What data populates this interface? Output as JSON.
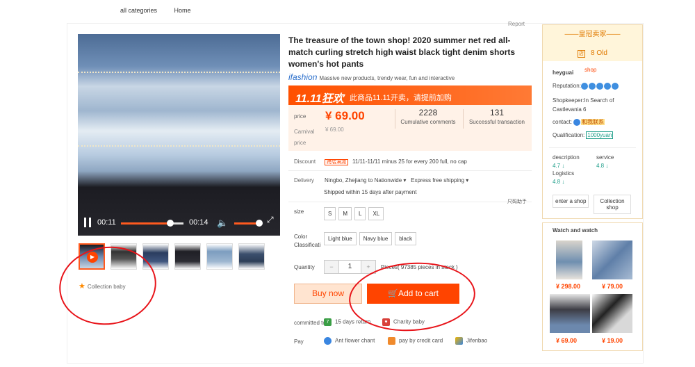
{
  "nav": {
    "all_categories": "all categories",
    "home": "Home"
  },
  "report": "Report",
  "video": {
    "current_time": "00:11",
    "total_time": "00:14",
    "progress": 0.79,
    "volume": 0.85
  },
  "thumbnails": [
    {
      "name": "thumb-1",
      "active": true
    },
    {
      "name": "thumb-2",
      "active": false
    },
    {
      "name": "thumb-3",
      "active": false
    },
    {
      "name": "thumb-4",
      "active": false
    },
    {
      "name": "thumb-5",
      "active": false
    },
    {
      "name": "thumb-6",
      "active": false
    }
  ],
  "collection": "Collection baby",
  "product": {
    "title": "The treasure of the town shop! 2020 summer net red all-match curling stretch high waist black tight denim shorts women's hot pants",
    "ifashion_logo": "ifashion",
    "ifashion_text": "Massive new products, trendy wear, fun and interactive",
    "banner_big": "11.11狂欢",
    "banner_text": "此商品11.11开卖，请提前加购"
  },
  "price": {
    "label": "price",
    "value": "¥ 69.00",
    "carnival_label": "Carnival price",
    "carnival_value": "¥ 69.00",
    "comments_count": "2228",
    "comments_label": "Cumulative comments",
    "transactions_count": "131",
    "transactions_label": "Successful transaction"
  },
  "discount": {
    "label": "Discount",
    "tag": "跨店满减",
    "text": "11/11-11/11 minus 25 for every 200 full, no cap"
  },
  "delivery": {
    "label": "Delivery",
    "route": "Ningbo, Zhejiang to Nationwide",
    "shipping": "Express free shipping",
    "time": "Shipped within 15 days after payment",
    "size_helper": "尺码助手"
  },
  "size": {
    "label": "size",
    "options": [
      "S",
      "M",
      "L",
      "XL"
    ]
  },
  "color": {
    "label": "Color Classificati",
    "options": [
      "Light blue",
      "Navy blue",
      "black"
    ]
  },
  "quantity": {
    "label": "Quantity",
    "minus": "−",
    "value": "1",
    "plus": "+",
    "stock": "Pieces( 97385 pieces in stock )"
  },
  "buttons": {
    "buy_now": "Buy now",
    "add_to_cart": "Add   to cart"
  },
  "services": {
    "committed_label": "committed to",
    "return": "15 days return",
    "charity": "Charity baby",
    "pay_label": "Pay",
    "ant": "Ant flower chant",
    "credit": "pay by credit card",
    "jifenbao": "Jifenbao"
  },
  "seller": {
    "crown": "皇冠卖家",
    "level": "8 Old",
    "name": "heyguai",
    "shop_link": "shop",
    "reputation_label": "Reputation:",
    "shopkeeper_label": "Shopkeeper:",
    "shopkeeper_value": "In Search of Castlevania 6",
    "contact_label": "contact:",
    "contact_value": "和我联系",
    "qualification_label": "Qualification:",
    "qualification_value": "1000yuan",
    "description_label": "description",
    "description_value": "4.7",
    "service_label": "service",
    "service_value": "4.8",
    "logistics_label": "Logistics",
    "logistics_value": "4.8",
    "enter_shop": "enter a shop",
    "collection_shop": "Collection shop"
  },
  "watch": {
    "title": "Watch and watch",
    "items": [
      {
        "price": "¥ 298.00"
      },
      {
        "price": "¥ 79.00"
      },
      {
        "price": "¥ 69.00"
      },
      {
        "price": "¥ 19.00"
      }
    ]
  },
  "colors": {
    "accent": "#ff4400",
    "annotation": "#e8141a",
    "teal": "#1f9e8a"
  }
}
